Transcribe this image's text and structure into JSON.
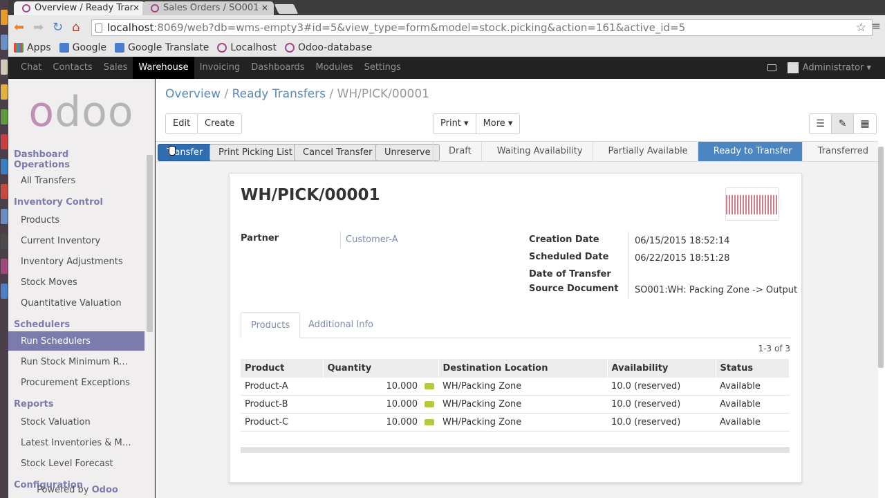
{
  "browser": {
    "tabs": [
      {
        "title": "Overview / Ready Trar",
        "close": "×"
      },
      {
        "title": "Sales Orders / SO001",
        "close": "×"
      }
    ],
    "url_host": "localhost",
    "url_rest": ":8069/web?db=wms-empty3#id=5&view_type=form&model=stock.picking&action=161&active_id=5",
    "bookmarks": [
      "Apps",
      "Google",
      "Google Translate",
      "Localhost",
      "Odoo-database"
    ]
  },
  "topnav": {
    "items": [
      "Chat",
      "Contacts",
      "Sales",
      "Warehouse",
      "Invoicing",
      "Dashboards",
      "Modules",
      "Settings"
    ],
    "active": "Warehouse",
    "user": "Administrator ▾"
  },
  "sidebar": {
    "logo": [
      "o",
      "doo"
    ],
    "sections": [
      {
        "header": "Dashboard Operations",
        "items": [
          "All Transfers"
        ]
      },
      {
        "header": "Inventory Control",
        "items": [
          "Products",
          "Current Inventory",
          "Inventory Adjustments",
          "Stock Moves",
          "Quantitative Valuation"
        ]
      },
      {
        "header": "Schedulers",
        "items": [
          "Run Schedulers",
          "Run Stock Minimum Rul...",
          "Procurement Exceptions"
        ]
      },
      {
        "header": "Reports",
        "items": [
          "Stock Valuation",
          "Latest Inventories & Mo...",
          "Stock Level Forecast"
        ]
      },
      {
        "header": "Configuration",
        "items": []
      }
    ],
    "active_item": "Run Schedulers",
    "powered_by": "Powered by",
    "powered_brand": "Odoo"
  },
  "breadcrumb": {
    "overview": "Overview",
    "ready": "Ready Transfers",
    "current": "WH/PICK/00001",
    "sep": "/"
  },
  "toolbar": {
    "edit": "Edit",
    "create": "Create",
    "print": "Print ▾",
    "more": "More ▾"
  },
  "actions": {
    "transfer": "Transfer",
    "print_picking": "Print Picking List",
    "cancel": "Cancel Transfer",
    "unreserve": "Unreserve"
  },
  "stages": [
    "Draft",
    "Waiting Availability",
    "Partially Available",
    "Ready to Transfer",
    "Transferred"
  ],
  "current_stage": "Ready to Transfer",
  "form": {
    "title": "WH/PICK/00001",
    "partner_label": "Partner",
    "partner_value": "Customer-A",
    "creation_label": "Creation Date",
    "creation_value": "06/15/2015 18:52:14",
    "scheduled_label": "Scheduled Date",
    "scheduled_value": "06/22/2015 18:51:28",
    "transfer_date_label": "Date of Transfer",
    "source_label": "Source Document",
    "source_value": "SO001:WH: Packing Zone -> Output"
  },
  "tabs": {
    "products": "Products",
    "additional": "Additional Info"
  },
  "pager": "1-3 of 3",
  "table": {
    "headers": [
      "Product",
      "Quantity",
      "Destination Location",
      "Availability",
      "Status"
    ],
    "rows": [
      [
        "Product-A",
        "10.000",
        "WH/Packing Zone",
        "10.0 (reserved)",
        "Available"
      ],
      [
        "Product-B",
        "10.000",
        "WH/Packing Zone",
        "10.0 (reserved)",
        "Available"
      ],
      [
        "Product-C",
        "10.000",
        "WH/Packing Zone",
        "10.0 (reserved)",
        "Available"
      ]
    ]
  },
  "colors": {
    "accent": "#7c7bad",
    "stage_active": "#4c86c2",
    "primary_button": "#2f6db0",
    "link": "#5a8ab8"
  }
}
